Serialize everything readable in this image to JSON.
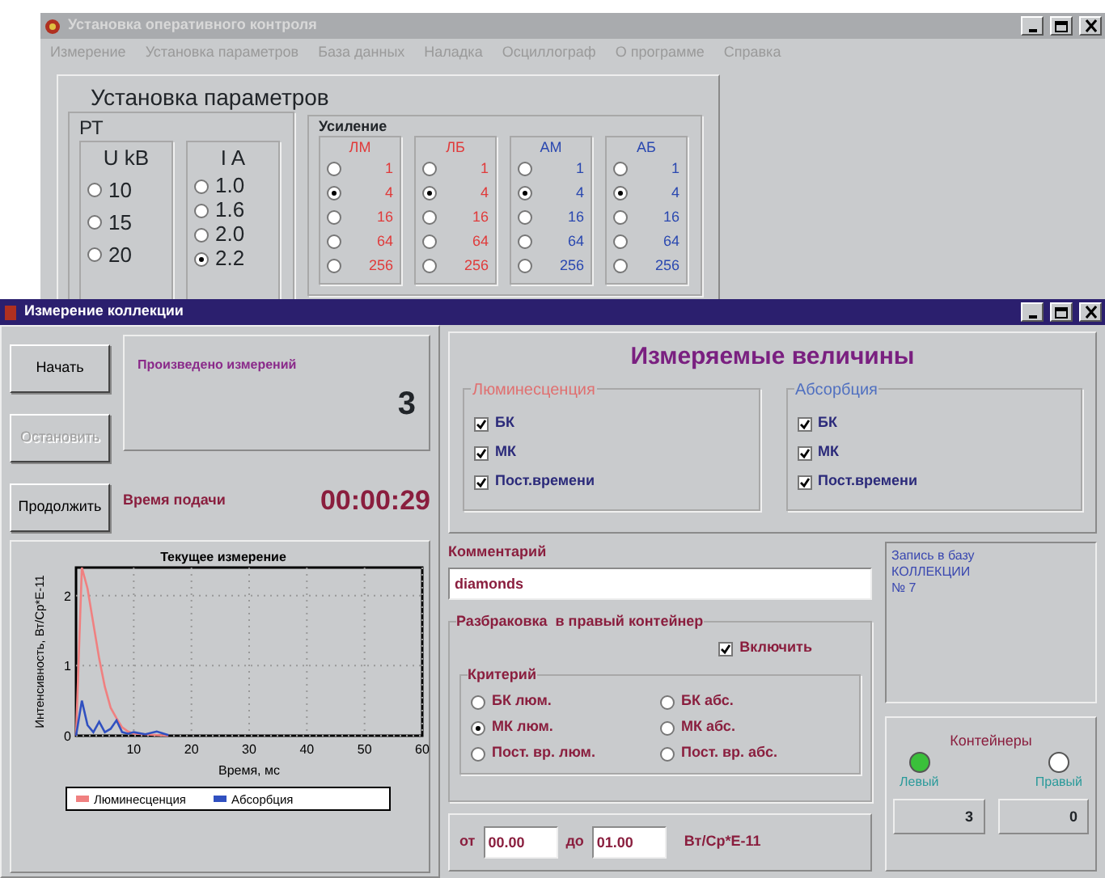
{
  "setup_window": {
    "title": "Установка оперативного контроля",
    "menu": [
      "Измерение",
      "Установка параметров",
      "База данных",
      "Наладка",
      "Осциллограф",
      "О программе",
      "Справка"
    ],
    "params": {
      "title": "Установка параметров",
      "rt": {
        "title": "РТ",
        "voltage": {
          "title": "U kB",
          "options": [
            {
              "label": "10",
              "selected": false
            },
            {
              "label": "15",
              "selected": false
            },
            {
              "label": "20",
              "selected": false
            }
          ]
        },
        "current": {
          "title": "I A",
          "options": [
            {
              "label": "1.0",
              "selected": false
            },
            {
              "label": "1.6",
              "selected": false
            },
            {
              "label": "2.0",
              "selected": false
            },
            {
              "label": "2.2",
              "selected": true
            }
          ]
        }
      },
      "gain": {
        "title": "Усиление",
        "groups": [
          {
            "title": "ЛМ",
            "color": "#e03a3a",
            "options": [
              {
                "label": "1",
                "selected": false
              },
              {
                "label": "4",
                "selected": true
              },
              {
                "label": "16",
                "selected": false
              },
              {
                "label": "64",
                "selected": false
              },
              {
                "label": "256",
                "selected": false
              }
            ]
          },
          {
            "title": "ЛБ",
            "color": "#e03a3a",
            "options": [
              {
                "label": "1",
                "selected": false
              },
              {
                "label": "4",
                "selected": true
              },
              {
                "label": "16",
                "selected": false
              },
              {
                "label": "64",
                "selected": false
              },
              {
                "label": "256",
                "selected": false
              }
            ]
          },
          {
            "title": "АМ",
            "color": "#2a48b0",
            "options": [
              {
                "label": "1",
                "selected": false
              },
              {
                "label": "4",
                "selected": true
              },
              {
                "label": "16",
                "selected": false
              },
              {
                "label": "64",
                "selected": false
              },
              {
                "label": "256",
                "selected": false
              }
            ]
          },
          {
            "title": "АБ",
            "color": "#2a48b0",
            "options": [
              {
                "label": "1",
                "selected": false
              },
              {
                "label": "4",
                "selected": true
              },
              {
                "label": "16",
                "selected": false
              },
              {
                "label": "64",
                "selected": false
              },
              {
                "label": "256",
                "selected": false
              }
            ]
          }
        ]
      }
    }
  },
  "measure_window": {
    "title": "Измерение коллекции",
    "buttons": [
      {
        "label": "Начать",
        "disabled": false
      },
      {
        "label": "Остановить",
        "disabled": true
      },
      {
        "label": "Продолжить",
        "disabled": false
      }
    ],
    "count": {
      "label": "Произведено измерений",
      "value": "3"
    },
    "feed_time": {
      "label": "Время подачи",
      "value": "00:00:29"
    },
    "chart": {
      "chart_data": {
        "type": "line",
        "title": "Текущее измерение",
        "xlabel": "Время, мс",
        "ylabel": "Интенсивность, Вт/Ср*Е-11",
        "x": [
          0,
          1,
          2,
          3,
          4,
          5,
          6,
          7,
          8,
          9,
          10,
          12,
          14,
          16
        ],
        "series": [
          {
            "name": "Люминесценция",
            "color": "#f08080",
            "values": [
              0,
              2.4,
              2.1,
              1.6,
              1.1,
              0.7,
              0.4,
              0.25,
              0.12,
              0.06,
              0.03,
              0.02,
              0.01,
              0
            ]
          },
          {
            "name": "Абсорбция",
            "color": "#3050c0",
            "values": [
              0,
              0.5,
              0.15,
              0.05,
              0.2,
              0.05,
              0.1,
              0.22,
              0.05,
              0.03,
              0.05,
              0.02,
              0.06,
              0.01
            ]
          }
        ],
        "xlim": [
          0,
          60
        ],
        "ylim": [
          0,
          2.4
        ],
        "xticks": [
          {
            "value": 10,
            "label": "10"
          },
          {
            "value": 20,
            "label": "20"
          },
          {
            "value": 30,
            "label": "30"
          },
          {
            "value": 40,
            "label": "40"
          },
          {
            "value": 50,
            "label": "50"
          },
          {
            "value": 60,
            "label": "60"
          }
        ],
        "yticks": [
          {
            "value": 0,
            "label": "0"
          },
          {
            "value": 1,
            "label": "1"
          },
          {
            "value": 2,
            "label": "2"
          }
        ],
        "grid": true,
        "legend": true
      }
    },
    "measured": {
      "title": "Измеряемые величины",
      "groups": [
        {
          "title": "Люминесценция",
          "color": "#e07070",
          "items": [
            {
              "label": "БК",
              "checked": true
            },
            {
              "label": "МК",
              "checked": true
            },
            {
              "label": "Пост.времени",
              "checked": true
            }
          ]
        },
        {
          "title": "Абсорбция",
          "color": "#5070c0",
          "items": [
            {
              "label": "БК",
              "checked": true
            },
            {
              "label": "МК",
              "checked": true
            },
            {
              "label": "Пост.времени",
              "checked": true
            }
          ]
        }
      ]
    },
    "comment": {
      "label": "Комментарий",
      "value": "diamonds"
    },
    "db_note": [
      "Запись в базу",
      "КОЛЛЕКЦИИ",
      "№ 7"
    ],
    "sorting": {
      "title": "Разбраковка  в правый контейнер",
      "enable": {
        "label": "Включить",
        "checked": true
      },
      "criterion": {
        "title": "Критерий",
        "options": [
          {
            "label": "БК люм.",
            "selected": false
          },
          {
            "label": "МК люм.",
            "selected": true
          },
          {
            "label": "Пост. вр. люм.",
            "selected": false
          },
          {
            "label": "БК абс.",
            "selected": false
          },
          {
            "label": "МК абс.",
            "selected": false
          },
          {
            "label": "Пост. вр. абс.",
            "selected": false
          }
        ]
      },
      "range": {
        "from_label": "от",
        "from": "00.00",
        "to_label": "до",
        "to": "01.00",
        "unit": "Вт/Ср*Е-11"
      }
    },
    "containers": {
      "title": "Контейнеры",
      "items": [
        {
          "label": "Левый",
          "on": true,
          "count": "3"
        },
        {
          "label": "Правый",
          "on": false,
          "count": "0"
        }
      ]
    }
  }
}
